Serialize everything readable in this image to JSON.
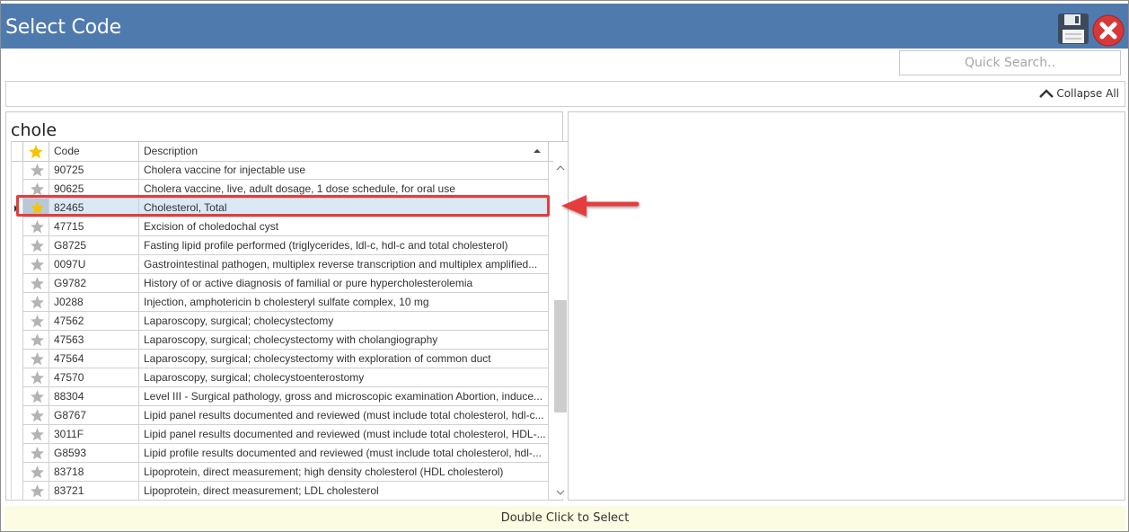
{
  "window": {
    "title": "Select Code"
  },
  "toolbar": {
    "save_icon": "floppy-disk-icon",
    "close_icon": "red-x-close-icon"
  },
  "search": {
    "placeholder": "Quick Search.."
  },
  "collapse": {
    "label": "Collapse All",
    "icon": "chevron-up-icon"
  },
  "filter": {
    "text": "chole"
  },
  "grid": {
    "headers": {
      "code": "Code",
      "description": "Description"
    },
    "sorted_by": "Description",
    "sort_direction": "ascending",
    "selected_index": 2,
    "rows": [
      {
        "code": "90725",
        "description": "Cholera vaccine for injectable use",
        "favorite": false
      },
      {
        "code": "90625",
        "description": "Cholera vaccine, live, adult dosage, 1 dose schedule, for oral use",
        "favorite": false
      },
      {
        "code": "82465",
        "description": "Cholesterol, Total",
        "favorite": true
      },
      {
        "code": "47715",
        "description": "Excision of choledochal cyst",
        "favorite": false
      },
      {
        "code": "G8725",
        "description": "Fasting lipid profile performed (triglycerides, ldl-c, hdl-c and total cholesterol)",
        "favorite": false
      },
      {
        "code": "0097U",
        "description": "Gastrointestinal pathogen, multiplex reverse transcription and multiplex amplified...",
        "favorite": false
      },
      {
        "code": "G9782",
        "description": "History of or active diagnosis of familial or pure hypercholesterolemia",
        "favorite": false
      },
      {
        "code": "J0288",
        "description": "Injection, amphotericin b cholesteryl sulfate complex, 10 mg",
        "favorite": false
      },
      {
        "code": "47562",
        "description": "Laparoscopy, surgical; cholecystectomy",
        "favorite": false
      },
      {
        "code": "47563",
        "description": "Laparoscopy, surgical; cholecystectomy with cholangiography",
        "favorite": false
      },
      {
        "code": "47564",
        "description": "Laparoscopy, surgical; cholecystectomy with exploration of common duct",
        "favorite": false
      },
      {
        "code": "47570",
        "description": "Laparoscopy, surgical; cholecystoenterostomy",
        "favorite": false
      },
      {
        "code": "88304",
        "description": "Level III - Surgical pathology, gross and microscopic examination Abortion, induce...",
        "favorite": false
      },
      {
        "code": "G8767",
        "description": "Lipid panel results documented and reviewed (must include total cholesterol, hdl-c...",
        "favorite": false
      },
      {
        "code": "3011F",
        "description": "Lipid panel results documented and reviewed (must include total cholesterol, HDL-...",
        "favorite": false
      },
      {
        "code": "G8593",
        "description": "Lipid profile results documented and reviewed (must include total cholesterol, hdl-...",
        "favorite": false
      },
      {
        "code": "83718",
        "description": "Lipoprotein, direct measurement; high density cholesterol (HDL cholesterol)",
        "favorite": false
      },
      {
        "code": "83721",
        "description": "Lipoprotein, direct measurement; LDL cholesterol",
        "favorite": false
      }
    ]
  },
  "footer": {
    "hint": "Double Click to Select"
  },
  "colors": {
    "titlebar": "#4f7aae",
    "star_favorite": "#f5c400",
    "star_default": "#b4b4b4",
    "annotation": "#e53d3d",
    "footer_bg": "#fcfce3"
  }
}
